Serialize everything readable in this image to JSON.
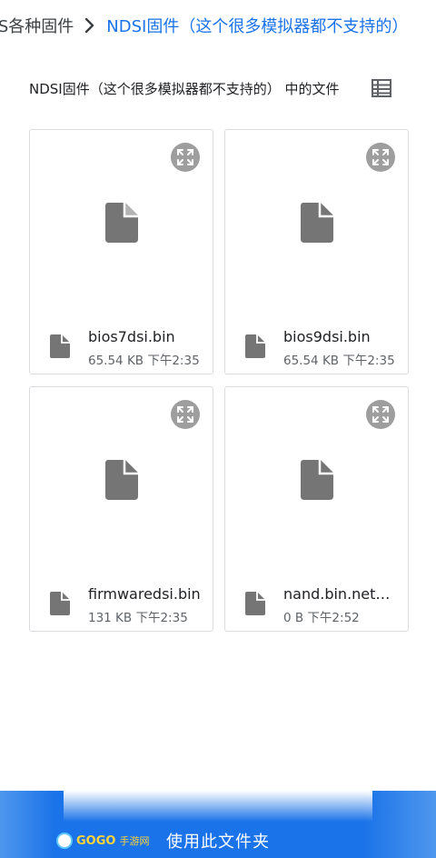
{
  "breadcrumb": {
    "previous": "DS各种固件",
    "current": "NDSI固件（这个很多模拟器都不支持的）"
  },
  "section": {
    "title": "NDSI固件（这个很多模拟器都不支持的） 中的文件"
  },
  "files": [
    {
      "name": "bios7dsi.bin",
      "meta": "65.54 KB 下午2:35"
    },
    {
      "name": "bios9dsi.bin",
      "meta": "65.54 KB 下午2:35"
    },
    {
      "name": "firmwaredsi.bin",
      "meta": "131 KB 下午2:35"
    },
    {
      "name": "nand.bin.netcode",
      "meta": "0 B 下午2:52"
    }
  ],
  "action": {
    "use_folder_label": "使用此文件夹"
  },
  "watermark": {
    "brand": "GOGO",
    "sub": "手游网"
  },
  "colors": {
    "accent": "#1a73e8",
    "icon_gray": "#757575",
    "expand_bg": "#9e9e9e"
  },
  "icons": {
    "breadcrumb_separator": "chevron-right-icon",
    "view_toggle": "list-view-icon",
    "expand": "fullscreen-icon",
    "file": "file-icon"
  }
}
